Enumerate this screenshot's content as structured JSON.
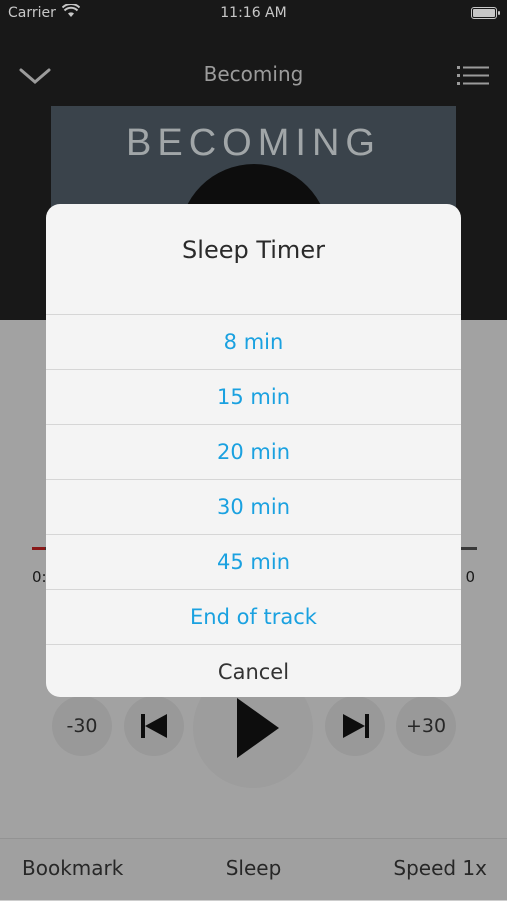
{
  "status_bar": {
    "carrier": "Carrier",
    "time": "11:16 AM"
  },
  "nav": {
    "title": "Becoming",
    "collapse_icon": "chevron-down-icon",
    "menu_icon": "list-icon"
  },
  "cover": {
    "title": "BECOMING"
  },
  "playback": {
    "elapsed": "0:",
    "remaining": "0",
    "progress_fraction": 0.03,
    "back_label": "-30",
    "forward_label": "+30"
  },
  "dialog": {
    "title": "Sleep Timer",
    "options": [
      "8 min",
      "15 min",
      "20 min",
      "30 min",
      "45 min",
      "End of track"
    ],
    "cancel": "Cancel"
  },
  "bottom_bar": {
    "bookmark": "Bookmark",
    "sleep": "Sleep",
    "speed": "Speed 1x"
  },
  "colors": {
    "accent": "#1aa1e0",
    "progress": "#b01f1f"
  }
}
